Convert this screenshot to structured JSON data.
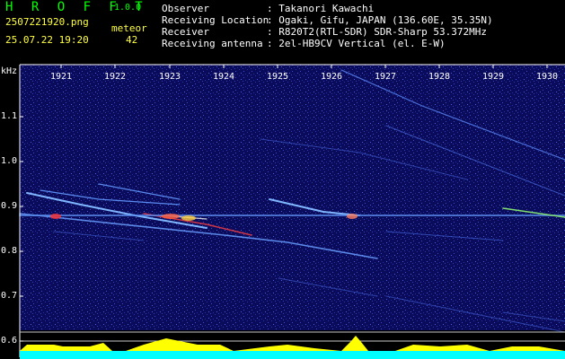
{
  "header": {
    "app_name": "H R O F F T",
    "version": "1.0.0",
    "filename": "2507221920.png",
    "datetime": "25.07.22 19:20",
    "meteor_label": "meteor",
    "meteor_count": "42"
  },
  "info": [
    {
      "key": "Observer",
      "value": ": Takanori Kawachi"
    },
    {
      "key": "Receiving Location",
      "value": ": Ogaki, Gifu, JAPAN (136.60E, 35.35N)"
    },
    {
      "key": "Receiver",
      "value": ": R820T2(RTL-SDR) SDR-Sharp 53.372MHz"
    },
    {
      "key": "Receiving antenna",
      "value": ": 2el-HB9CV Vertical (el. E-W)"
    }
  ],
  "axis": {
    "y_unit": "kHz",
    "y_ticks": [
      "1.1",
      "1.0",
      "0.9",
      "0.8",
      "0.7",
      "0.6"
    ],
    "x_ticks": [
      "1921",
      "1922",
      "1923",
      "1924",
      "1925",
      "1926",
      "1927",
      "1928",
      "1929",
      "1930"
    ]
  },
  "colors": {
    "background": "#000000",
    "spectrogram": "#0a0a60",
    "trace": "#7fb6ff",
    "hot": "#ff3030",
    "level": "#ffff00",
    "baseline": "#00ffff"
  }
}
